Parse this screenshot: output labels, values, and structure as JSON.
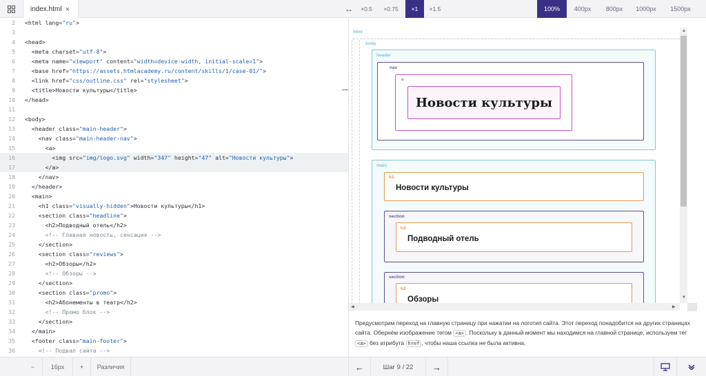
{
  "topbar": {
    "tree_icon": "grid-icon",
    "tab_label": "index.html",
    "tab_close": "×",
    "resize_icon": "↔",
    "scales": [
      "×0.5",
      "×0.75",
      "×1",
      "×1.5"
    ],
    "active_scale": "×1",
    "widths": [
      "100%",
      "400px",
      "800px",
      "1000px",
      "1500px"
    ],
    "active_width": "100%"
  },
  "editor": {
    "lines": [
      {
        "n": "2",
        "html": "&lt;html lang=<span class='val'>\"ru\"</span>&gt;"
      },
      {
        "n": "3",
        "html": ""
      },
      {
        "n": "4",
        "html": "&lt;head&gt;"
      },
      {
        "n": "5",
        "html": "  &lt;meta charset=<span class='val'>\"utf-8\"</span>&gt;"
      },
      {
        "n": "6",
        "html": "  &lt;meta name=<span class='val'>\"viewport\"</span> content=<span class='val'>\"width=device-width, initial-scale=1\"</span>&gt;"
      },
      {
        "n": "7",
        "html": "  &lt;base href=<span class='val'>\"https://assets.htmlacademy.ru/content/skills/1/case-01/\"</span>&gt;"
      },
      {
        "n": "8",
        "html": "  &lt;link href=<span class='val'>\"css/outline.css\"</span> rel=<span class='val'>\"stylesheet\"</span>&gt;"
      },
      {
        "n": "9",
        "html": "  &lt;title&gt;Новости культуры&lt;/title&gt;"
      },
      {
        "n": "10",
        "html": "&lt;/head&gt;"
      },
      {
        "n": "11",
        "html": ""
      },
      {
        "n": "12",
        "html": "&lt;body&gt;"
      },
      {
        "n": "13",
        "html": "  &lt;header class=<span class='val'>\"main-header\"</span>&gt;"
      },
      {
        "n": "14",
        "html": "    &lt;nav class=<span class='val'>\"main-header-nav\"</span>&gt;"
      },
      {
        "n": "15",
        "html": "      &lt;a&gt;"
      },
      {
        "n": "16",
        "html": "        &lt;img src=<span class='val'>\"img/logo.svg\"</span> width=<span class='val'>\"347\"</span> height=<span class='val'>\"47\"</span> alt=<span class='val'>\"Новости культуры\"</span>&gt;"
      },
      {
        "n": "17",
        "html": "      &lt;/a&gt;"
      },
      {
        "n": "18",
        "html": "    &lt;/nav&gt;"
      },
      {
        "n": "19",
        "html": "  &lt;/header&gt;"
      },
      {
        "n": "20",
        "html": "  &lt;main&gt;"
      },
      {
        "n": "21",
        "html": "    &lt;h1 class=<span class='val'>\"visually-hidden\"</span>&gt;Новости культуры&lt;/h1&gt;"
      },
      {
        "n": "22",
        "html": "    &lt;section class=<span class='val'>\"headline\"</span>&gt;"
      },
      {
        "n": "23",
        "html": "      &lt;h2&gt;Подводный отель&lt;/h2&gt;"
      },
      {
        "n": "24",
        "html": "      <span class='cmt'>&lt;!-- Главная новость, сенсация --&gt;</span>"
      },
      {
        "n": "25",
        "html": "    &lt;/section&gt;"
      },
      {
        "n": "26",
        "html": "    &lt;section class=<span class='val'>\"reviews\"</span>&gt;"
      },
      {
        "n": "27",
        "html": "      &lt;h2&gt;Обзоры&lt;/h2&gt;"
      },
      {
        "n": "28",
        "html": "      <span class='cmt'>&lt;!-- Обзоры --&gt;</span>"
      },
      {
        "n": "29",
        "html": "    &lt;/section&gt;"
      },
      {
        "n": "30",
        "html": "    &lt;section class=<span class='val'>\"promo\"</span>&gt;"
      },
      {
        "n": "31",
        "html": "      &lt;h2&gt;Абонементы в театр&lt;/h2&gt;"
      },
      {
        "n": "32",
        "html": "      <span class='cmt'>&lt;!-- Промо блок --&gt;</span>"
      },
      {
        "n": "33",
        "html": "    &lt;/section&gt;"
      },
      {
        "n": "34",
        "html": "  &lt;/main&gt;"
      },
      {
        "n": "35",
        "html": "  &lt;footer class=<span class='val'>\"main-footer\"</span>&gt;"
      },
      {
        "n": "36",
        "html": "    <span class='cmt'>&lt;!-- Подвал сайта --&gt;</span>"
      }
    ],
    "highlighted_lines": [
      "16",
      "17"
    ],
    "footer": {
      "minus": "−",
      "font_size": "16px",
      "plus": "+",
      "diff": "Различия"
    }
  },
  "preview": {
    "labels": {
      "html": "html",
      "body": "body",
      "header": "header",
      "nav": "nav",
      "a": "a",
      "main": "main",
      "h1": "h1",
      "section": "section",
      "h2": "h2"
    },
    "logo_text": "Новости культуры",
    "h1_text": "Новости культуры",
    "h2_texts": [
      "Подводный отель",
      "Обзоры"
    ],
    "label_colors": {
      "outer": "#7fc4d8",
      "nav": "#6a6090",
      "a": "#c05bc0",
      "h": "#e4913e"
    }
  },
  "description": {
    "part1": "Предусмотрим переход на главную страницу при нажатии на логотип сайта. Этот переход понадобится на других страницах сайта. Обернём изображение тегом ",
    "code1": "<a>",
    "part2": ". Поскольку в данный момент мы находимся на главной странице, используем тег ",
    "code2": "<a>",
    "part3": " без атрибута ",
    "code3": "href",
    "part4": ", чтобы наша ссылка не была активна."
  },
  "steps": {
    "prev_icon": "←",
    "label": "Шаг 9 / 22",
    "next_icon": "→",
    "screen_icon": "monitor-icon",
    "collapse_icon": "chevron-down-icon"
  }
}
